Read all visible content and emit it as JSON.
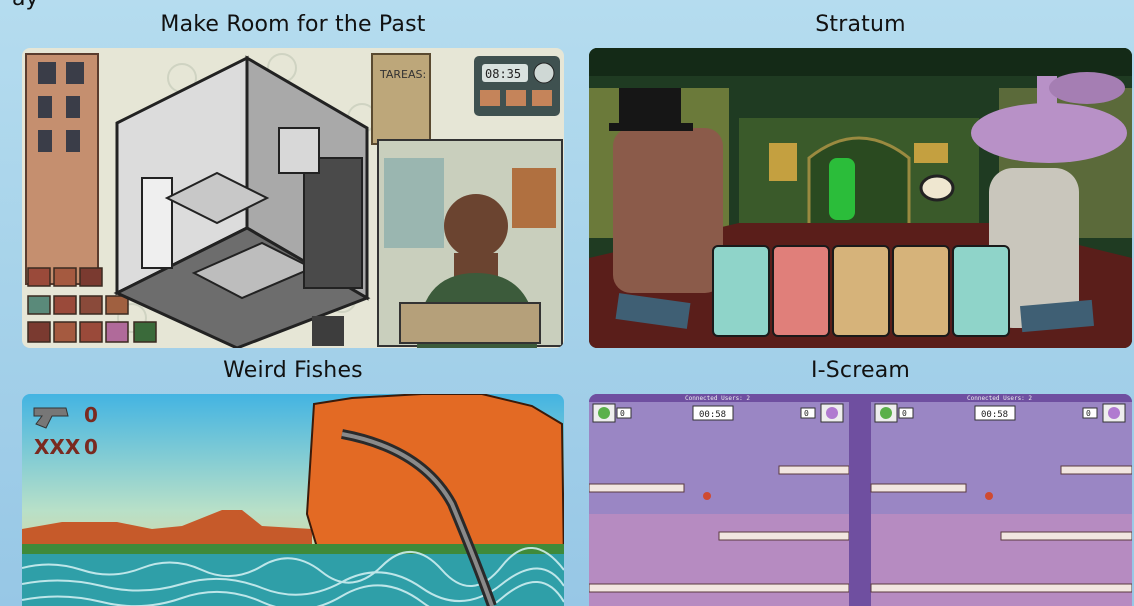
{
  "partial_heading": "ay",
  "games": [
    {
      "title": "Make Room for the Past",
      "overlay_texts": {
        "tasks_note": "TAREAS:",
        "clock": "08:35"
      }
    },
    {
      "title": "Stratum",
      "overlay_texts": {}
    },
    {
      "title": "Weird Fishes",
      "overlay_texts": {
        "counter_a": "0",
        "xxx": "XXX",
        "counter_b": "0"
      }
    },
    {
      "title": "I-Scream",
      "overlay_texts": {
        "connected": "Connected Users: 2",
        "score_left": "0",
        "score_right": "0",
        "timer": "00:58"
      }
    }
  ],
  "colors": {
    "background": "#a7d3ea",
    "title_text": "#111111"
  }
}
